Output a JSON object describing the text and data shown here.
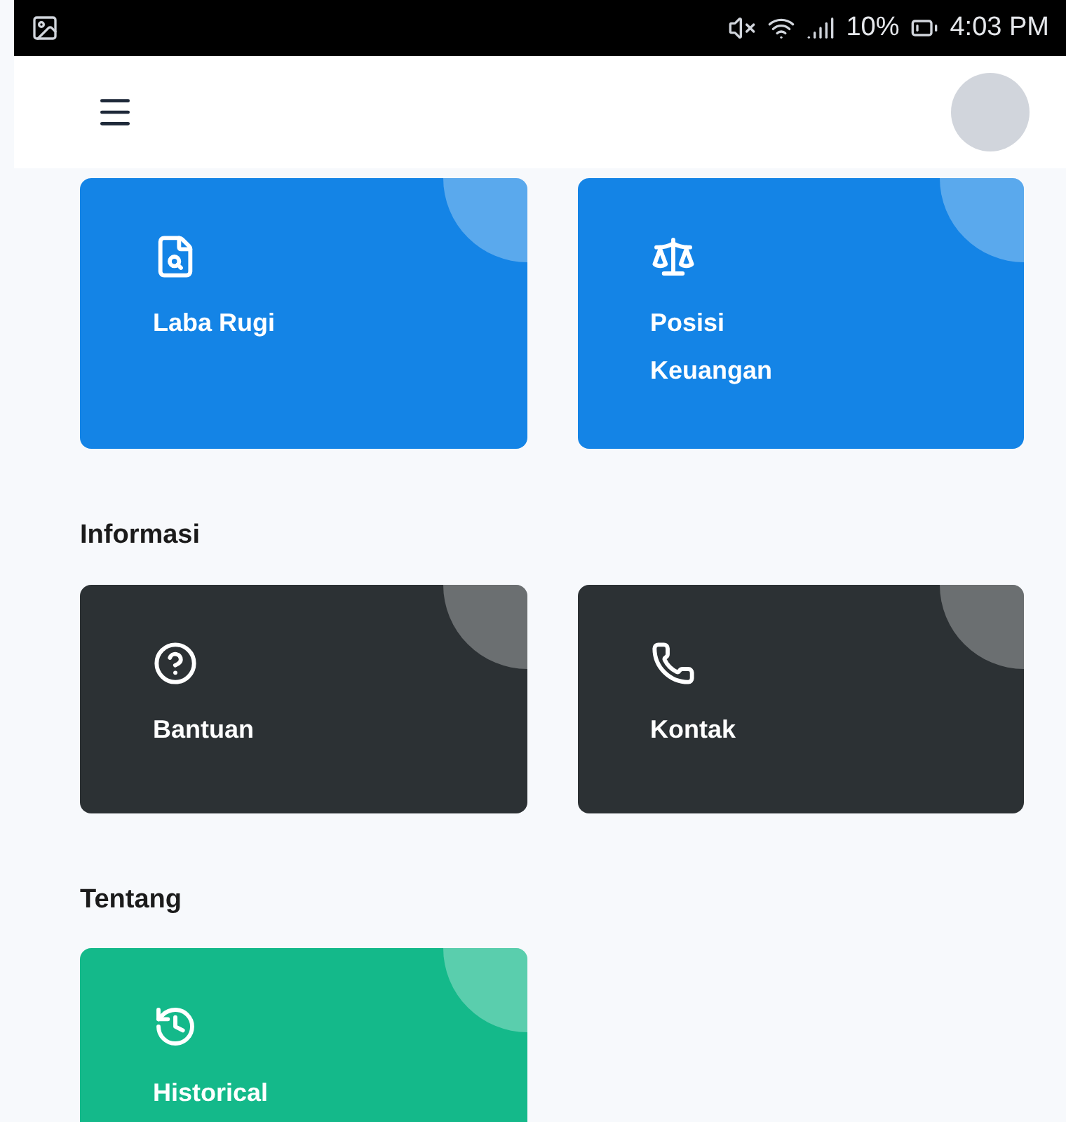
{
  "status_bar": {
    "battery": "10%",
    "time": "4:03 PM"
  },
  "sections": [
    {
      "cards": [
        {
          "label": "Laba Rugi",
          "color": "#1484e6"
        },
        {
          "label": "Posisi Keuangan",
          "color": "#1484e6"
        }
      ]
    },
    {
      "title": "Informasi",
      "cards": [
        {
          "label": "Bantuan",
          "color": "#2c3134"
        },
        {
          "label": "Kontak",
          "color": "#2c3134"
        }
      ]
    },
    {
      "title": "Tentang",
      "cards": [
        {
          "label": "Historical",
          "color": "#14b98a"
        }
      ]
    }
  ]
}
